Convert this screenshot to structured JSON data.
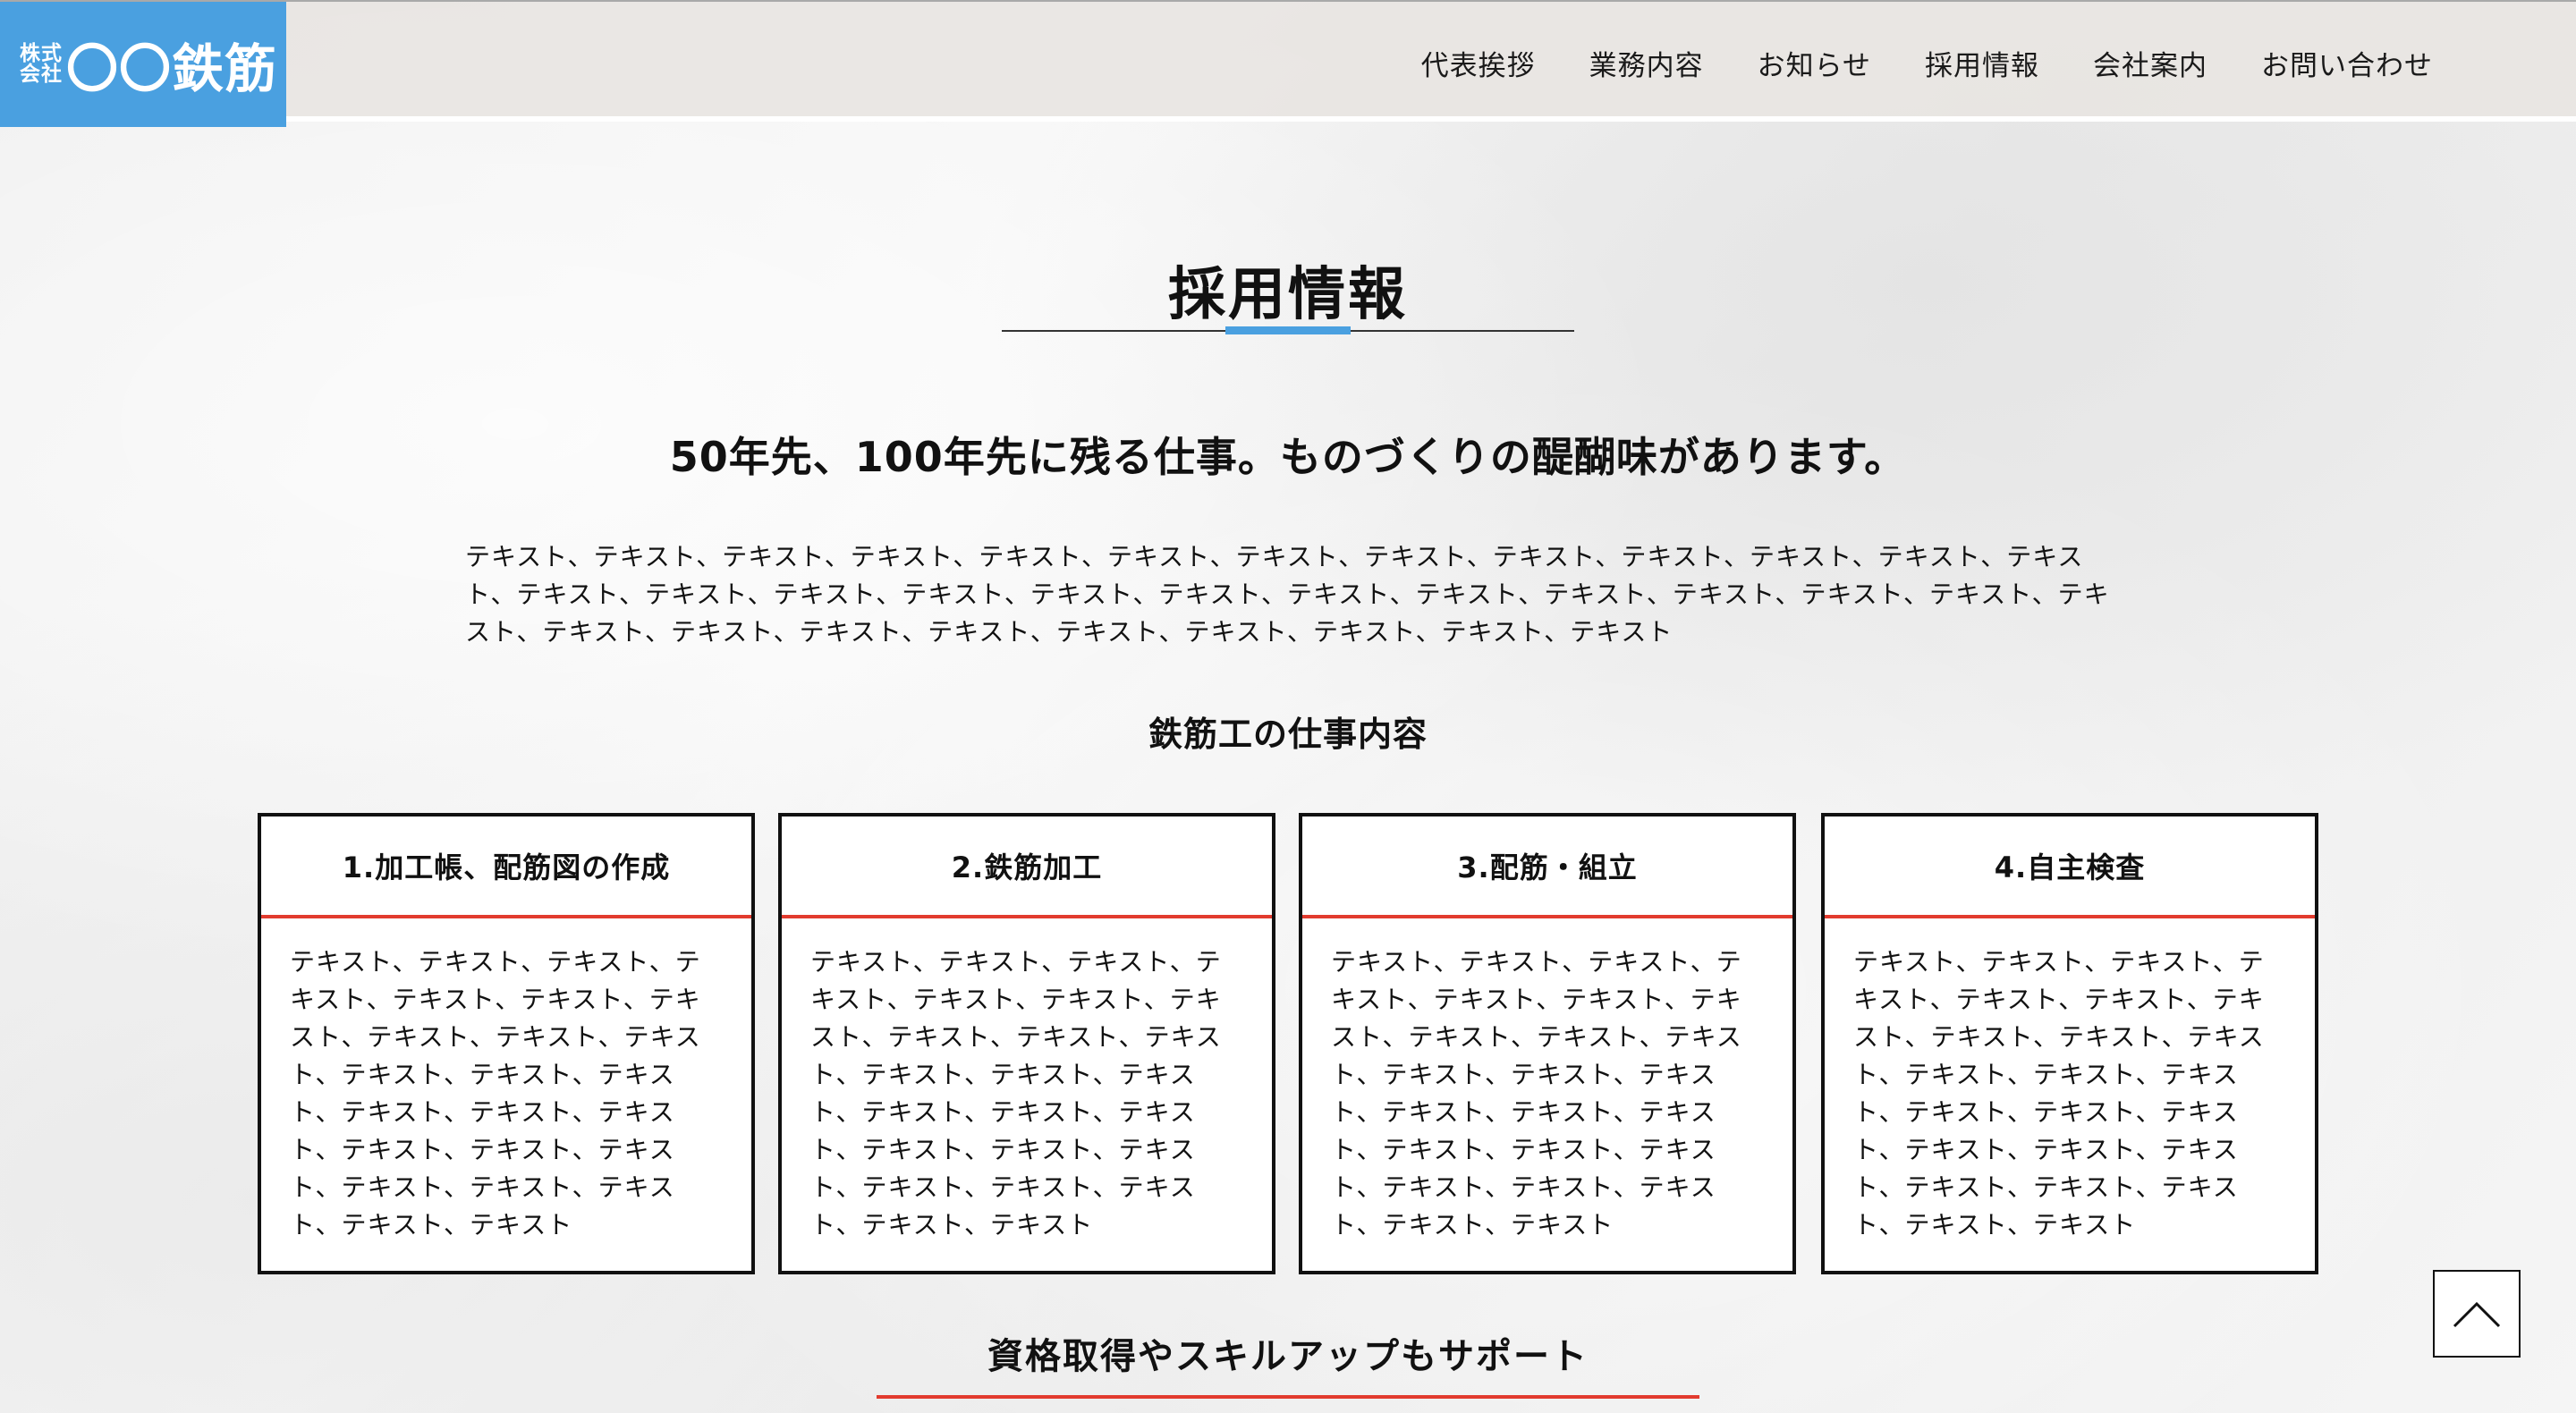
{
  "header": {
    "logo": {
      "small_line1": "株式",
      "small_line2": "会社",
      "main": "〇〇鉄筋"
    },
    "nav": [
      {
        "label": "代表挨拶"
      },
      {
        "label": "業務内容"
      },
      {
        "label": "お知らせ"
      },
      {
        "label": "採用情報"
      },
      {
        "label": "会社案内"
      },
      {
        "label": "お問い合わせ"
      }
    ]
  },
  "main": {
    "section_title": "採用情報",
    "catch_copy": "50年先、100年先に残る仕事。ものづくりの醍醐味があります。",
    "intro_text": "テキスト、テキスト、テキスト、テキスト、テキスト、テキスト、テキスト、テキスト、テキスト、テキスト、テキスト、テキスト、テキスト、テキスト、テキスト、テキスト、テキスト、テキスト、テキスト、テキスト、テキスト、テキスト、テキスト、テキスト、テキスト、テキスト、テキスト、テキスト、テキスト、テキスト、テキスト、テキスト、テキスト、テキスト、テキスト",
    "jobs_heading": "鉄筋工の仕事内容",
    "cards": [
      {
        "title": "1.加工帳、配筋図の作成",
        "body": "テキスト、テキスト、テキスト、テキスト、テキスト、テキスト、テキスト、テキスト、テキスト、テキスト、テキスト、テキスト、テキスト、テキスト、テキスト、テキスト、テキスト、テキスト、テキスト、テキスト、テキスト、テキスト、テキスト、テキスト"
      },
      {
        "title": "2.鉄筋加工",
        "body": "テキスト、テキスト、テキスト、テキスト、テキスト、テキスト、テキスト、テキスト、テキスト、テキスト、テキスト、テキスト、テキスト、テキスト、テキスト、テキスト、テキスト、テキスト、テキスト、テキスト、テキスト、テキスト、テキスト、テキスト"
      },
      {
        "title": "3.配筋・組立",
        "body": "テキスト、テキスト、テキスト、テキスト、テキスト、テキスト、テキスト、テキスト、テキスト、テキスト、テキスト、テキスト、テキスト、テキスト、テキスト、テキスト、テキスト、テキスト、テキスト、テキスト、テキスト、テキスト、テキスト、テキスト"
      },
      {
        "title": "4.自主検査",
        "body": "テキスト、テキスト、テキスト、テキスト、テキスト、テキスト、テキスト、テキスト、テキスト、テキスト、テキスト、テキスト、テキスト、テキスト、テキスト、テキスト、テキスト、テキスト、テキスト、テキスト、テキスト、テキスト、テキスト、テキスト"
      }
    ],
    "support_heading": "資格取得やスキルアップもサポート"
  },
  "back_to_top": {
    "icon": "chevron-up-icon"
  },
  "colors": {
    "brand_blue": "#4aa0e0",
    "accent_red": "#e23b2e"
  }
}
